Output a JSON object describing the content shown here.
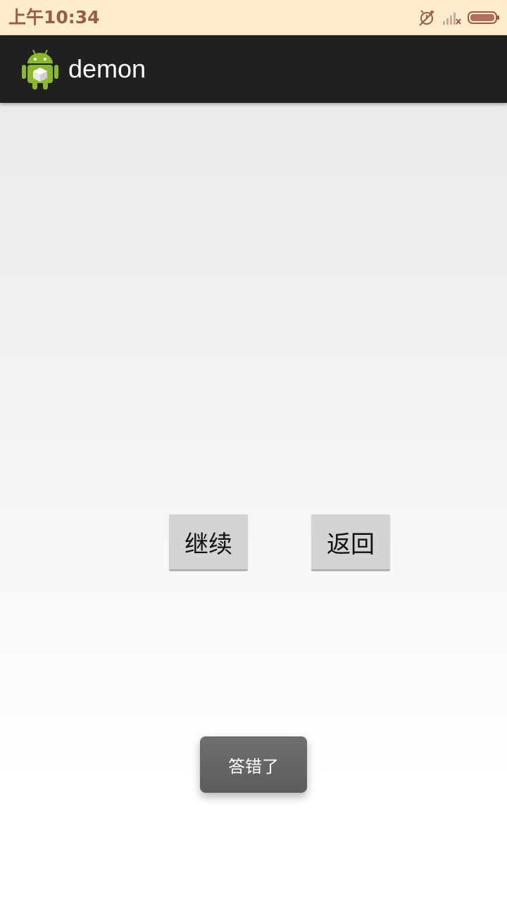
{
  "status_bar": {
    "time": "上午10:34",
    "icons": [
      "alarm-off-icon",
      "signal-weak-icon",
      "battery-icon"
    ],
    "text_color": "#9a5a46",
    "background": "#fdeccd"
  },
  "app_bar": {
    "title": "demon",
    "logo_icon": "android-robot-icon",
    "background": "#202020"
  },
  "buttons": {
    "continue_label": "继续",
    "back_label": "返回"
  },
  "toast": {
    "message": "答错了"
  }
}
